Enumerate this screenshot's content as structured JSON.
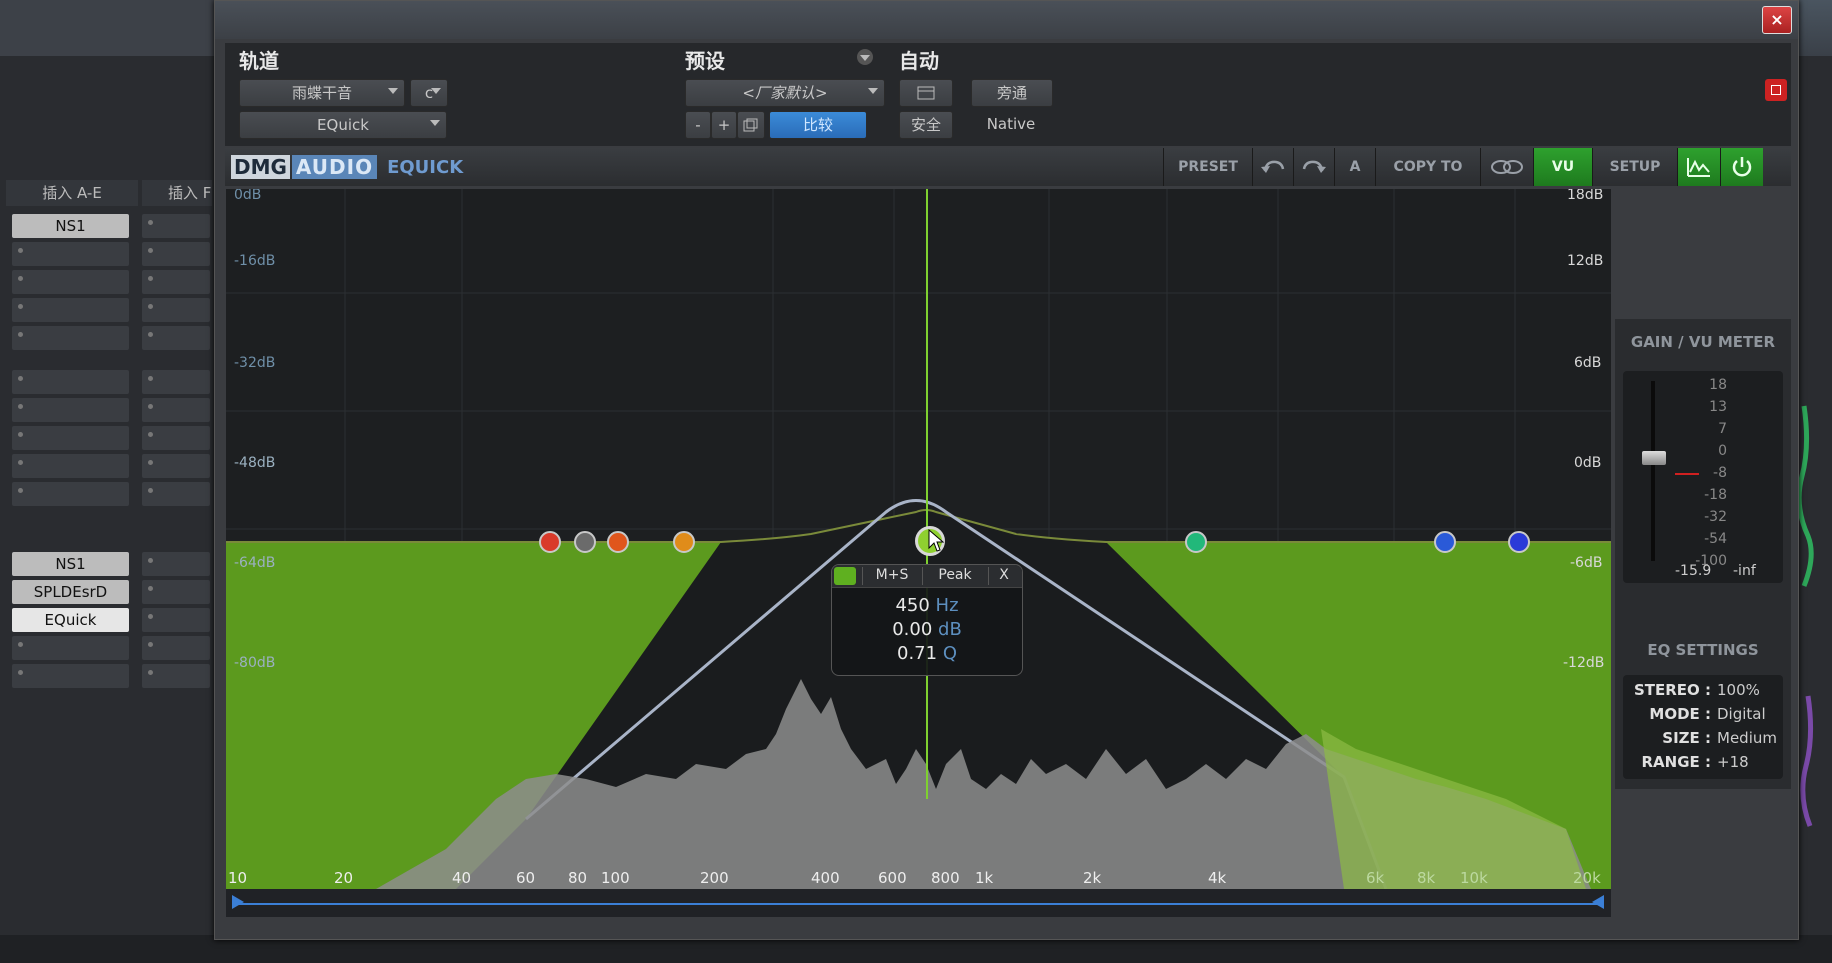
{
  "daw": {
    "insert_header_1": "插入 A-E",
    "insert_header_2": "插入 F",
    "plugins_top": [
      "NS1"
    ],
    "plugins_bottom": [
      "NS1",
      "SPLDEsrD",
      "EQuick"
    ]
  },
  "window": {
    "close_glyph": "×",
    "header": {
      "track_label": "轨道",
      "preset_label": "预设",
      "auto_label": "自动",
      "track_name": "雨蝶干音",
      "channel": "c",
      "insert_name": "EQuick",
      "preset_name": "<厂家默认>",
      "minus": "-",
      "plus": "+",
      "compare": "比较",
      "bypass": "旁通",
      "safe": "安全",
      "native": "Native"
    },
    "toolbar": {
      "brand_dmg": "DMG",
      "brand_audio": "AUDIO",
      "brand_product": "EQUICK",
      "preset": "PRESET",
      "a_label": "A",
      "copy_to": "COPY TO",
      "vu": "VU",
      "setup": "SETUP"
    },
    "graph": {
      "left_scale": [
        "0dB",
        "-16dB",
        "-32dB",
        "-48dB",
        "-64dB",
        "-80dB"
      ],
      "right_scale": [
        "18dB",
        "12dB",
        "6dB",
        "0dB",
        "-6dB",
        "-12dB"
      ],
      "freq_labels": [
        "10",
        "20",
        "40",
        "60",
        "80",
        "100",
        "200",
        "400",
        "600",
        "800",
        "1k",
        "2k",
        "4k",
        "6k",
        "8k",
        "10k",
        "20k"
      ],
      "node_colors": [
        "#d93a2a",
        "#6b6b6b",
        "#e0561c",
        "#e08c1a",
        "#8fd030",
        "#22b87a",
        "#2a5ad8",
        "#2a3ad8"
      ],
      "popup": {
        "mode": "M+S",
        "type": "Peak",
        "close": "X",
        "freq_value": "450",
        "freq_unit": "Hz",
        "gain_value": "0.00",
        "gain_unit": "dB",
        "q_value": "0.71",
        "q_unit": "Q"
      }
    },
    "side": {
      "gain_title": "GAIN / VU METER",
      "vu_scale": [
        "18",
        "13",
        "7",
        "0",
        "-8",
        "-18",
        "-32",
        "-54",
        "-100"
      ],
      "readout_left": "-15.9",
      "readout_right": "-inf",
      "eq_title": "EQ SETTINGS",
      "stereo_label": "STEREO :",
      "stereo_value": "100%",
      "mode_label": "MODE :",
      "mode_value": "Digital",
      "size_label": "SIZE :",
      "size_value": "Medium",
      "range_label": "RANGE :",
      "range_value": "+18"
    }
  }
}
